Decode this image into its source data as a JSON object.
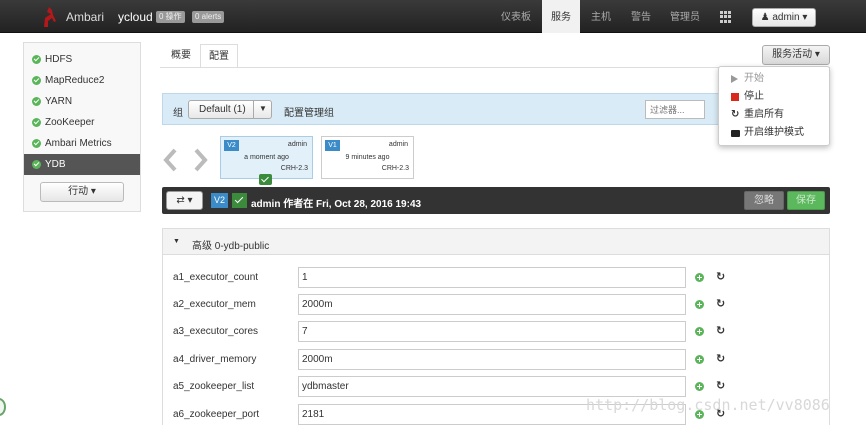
{
  "header": {
    "brand": "Ambari",
    "cluster": "ycloud",
    "ops_badge": "0 操作",
    "alerts_badge": "0 alerts",
    "nav": [
      "仪表板",
      "服务",
      "主机",
      "警告",
      "管理员"
    ],
    "active_nav": "服务",
    "user_menu": "admin ▾"
  },
  "sidebar": {
    "services": [
      "HDFS",
      "MapReduce2",
      "YARN",
      "ZooKeeper",
      "Ambari Metrics",
      "YDB"
    ],
    "active": "YDB",
    "action_button": "行动 ▾"
  },
  "tabs": [
    "概要",
    "配置"
  ],
  "service_actions": {
    "button": "服务活动 ▾",
    "items": [
      "开始",
      "停止",
      "重启所有",
      "开启维护模式"
    ]
  },
  "config_group": {
    "label": "组",
    "selected": "Default (1)",
    "manage": "配置管理组",
    "filter_placeholder": "过滤器..."
  },
  "versions": [
    {
      "tag": "V2",
      "author": "admin",
      "time": "a moment ago",
      "stack": "CRH-2.3",
      "current": true
    },
    {
      "tag": "V1",
      "author": "admin",
      "time": "9 minutes ago",
      "stack": "CRH-2.3",
      "current": false
    }
  ],
  "current_version_bar": {
    "tag": "V2",
    "text": "admin 作者在 Fri, Oct 28, 2016 19:43",
    "discard": "忽略",
    "save": "保存"
  },
  "section": {
    "title": "高级 0-ydb-public",
    "properties": [
      {
        "name": "a1_executor_count",
        "value": "1"
      },
      {
        "name": "a2_executor_mem",
        "value": "2000m"
      },
      {
        "name": "a3_executor_cores",
        "value": "7"
      },
      {
        "name": "a4_driver_memory",
        "value": "2000m"
      },
      {
        "name": "a5_zookeeper_list",
        "value": "ydbmaster"
      },
      {
        "name": "a6_zookeeper_port",
        "value": "2181"
      }
    ]
  },
  "watermark": "http://blog.csdn.net/vv8086",
  "colors": {
    "ok_green": "#5ab55a",
    "accent_blue": "#3a8bc8",
    "stop_red": "#d9291d",
    "group_bar": "#d9ebf6"
  }
}
